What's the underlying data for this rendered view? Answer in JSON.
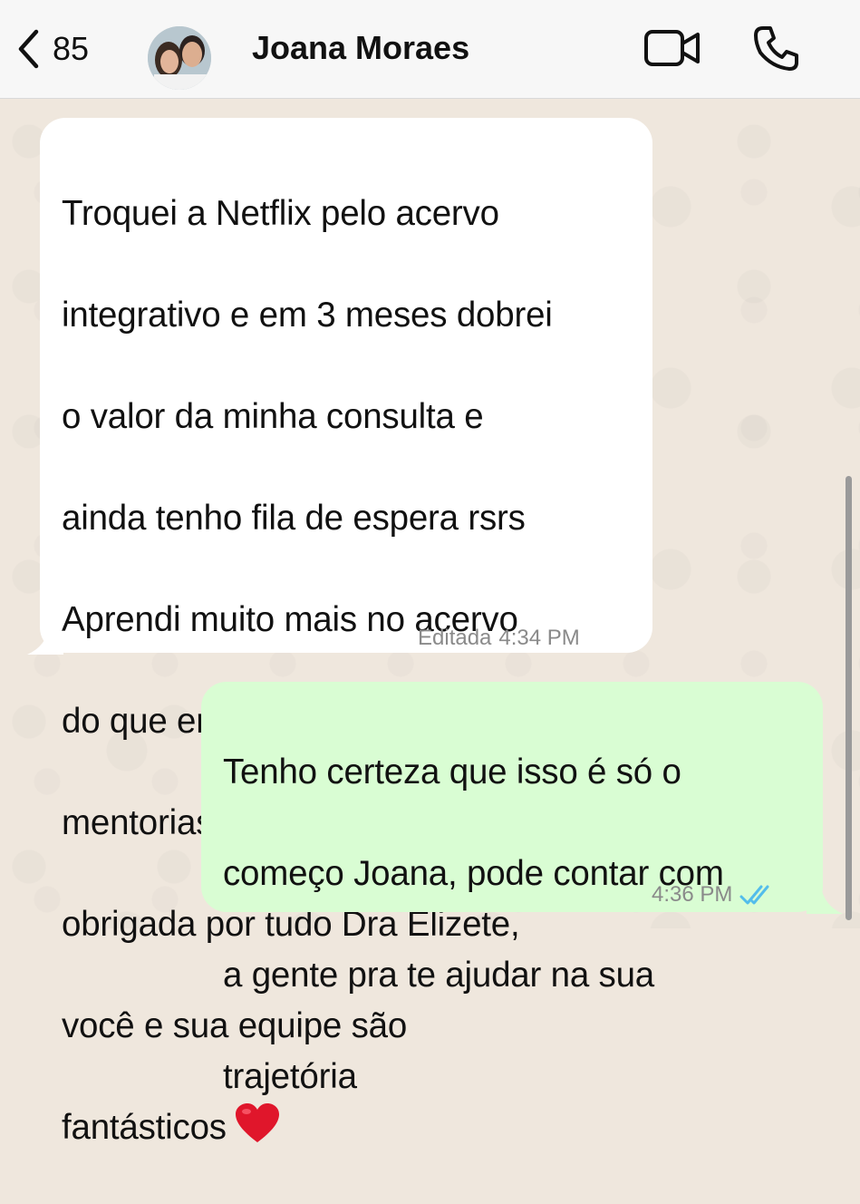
{
  "header": {
    "back_count": "85",
    "contact_name": "Joana Moraes"
  },
  "messages": [
    {
      "direction": "incoming",
      "lines": [
        "Troquei a Netflix pelo acervo",
        "integrativo e em 3 meses dobrei",
        "o valor da minha consulta e",
        "ainda tenho fila de espera rsrs",
        "Aprendi muito mais no acervo",
        "do que em congressos e",
        "mentorias caras que fiz, muito",
        "obrigada por tudo Dra Elizete,",
        "você e sua equipe são",
        "fantásticos"
      ],
      "emoji": "heart",
      "edited_label": "Editada",
      "time": "4:34 PM"
    },
    {
      "direction": "outgoing",
      "lines": [
        "Tenho certeza que isso é só o",
        "começo Joana, pode contar com",
        "a gente pra te ajudar na sua",
        "trajetória"
      ],
      "time": "4:36 PM",
      "status": "read"
    }
  ],
  "colors": {
    "incoming_bubble": "#ffffff",
    "outgoing_bubble": "#d9fdd3",
    "read_ticks": "#53bdeb",
    "wallpaper": "#efe7dd"
  }
}
